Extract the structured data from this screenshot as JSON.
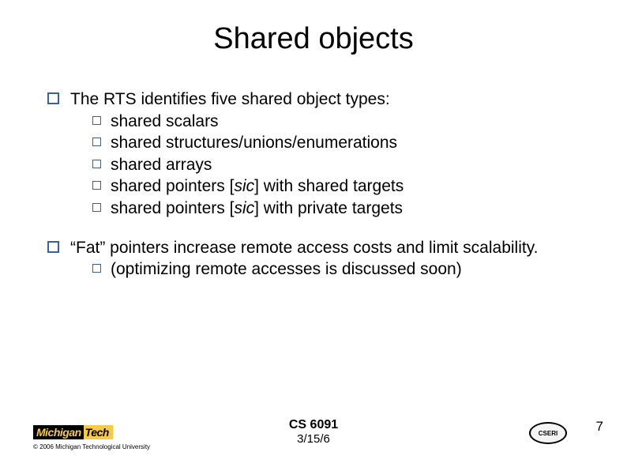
{
  "title": "Shared objects",
  "bullets": [
    {
      "text": "The RTS identifies five shared object types:",
      "children": [
        "shared scalars",
        "shared structures/unions/enumerations",
        "shared arrays",
        "shared pointers [sic] with shared targets",
        "shared pointers [sic] with private targets"
      ]
    },
    {
      "text": "“Fat” pointers increase remote access costs and limit scalability.",
      "children": [
        "(optimizing remote accesses is discussed soon)"
      ]
    }
  ],
  "footer": {
    "logo_black": "Michigan",
    "logo_gold": "Tech",
    "copyright": "© 2006 Michigan Technological University",
    "course": "CS 6091",
    "date": "3/15/6",
    "right_logo": "CSERI",
    "page": "7"
  }
}
